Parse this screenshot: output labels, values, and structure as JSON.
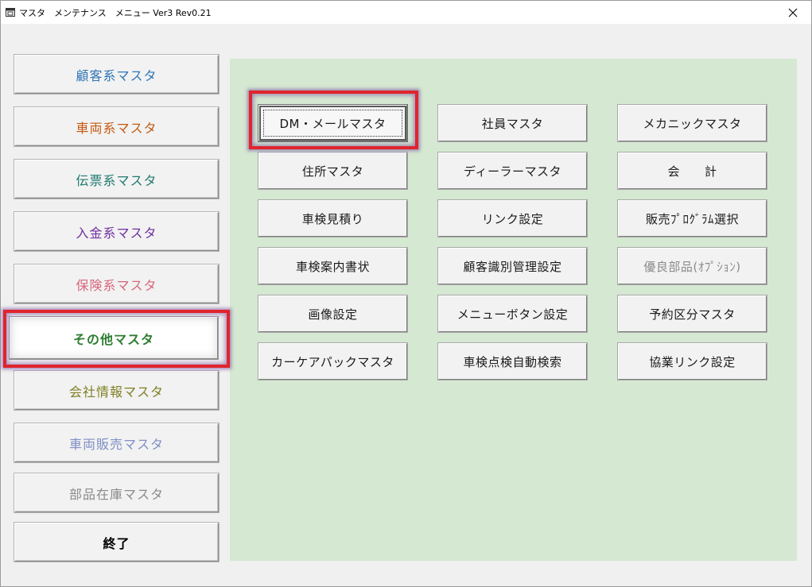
{
  "window": {
    "title": "マスタ　メンテナンス　メニュー Ver3 Rev0.21",
    "icon": "app-window-icon",
    "close_icon": "close-icon"
  },
  "sidebar": {
    "items": [
      {
        "label": "顧客系マスタ",
        "color": "#2e75b6"
      },
      {
        "label": "車両系マスタ",
        "color": "#c55a11"
      },
      {
        "label": "伝票系マスタ",
        "color": "#1f7a6f"
      },
      {
        "label": "入金系マスタ",
        "color": "#7030a0"
      },
      {
        "label": "保険系マスタ",
        "color": "#d6677a"
      },
      {
        "label": "その他マスタ",
        "color": "#2e7d32",
        "selected": true
      },
      {
        "label": "会社情報マスタ",
        "color": "#7f7f24"
      },
      {
        "label": "車両販売マスタ",
        "color": "#7f8fc6"
      },
      {
        "label": "部品在庫マスタ",
        "color": "#8a8a8a"
      },
      {
        "label": "終了",
        "color": "#000000"
      }
    ]
  },
  "grid": {
    "columns": [
      [
        {
          "label": "DM・メールマスタ",
          "focused": true
        },
        {
          "label": "住所マスタ"
        },
        {
          "label": "車検見積り"
        },
        {
          "label": "車検案内書状"
        },
        {
          "label": "画像設定"
        },
        {
          "label": "カーケアパックマスタ"
        }
      ],
      [
        {
          "label": "社員マスタ"
        },
        {
          "label": "ディーラーマスタ"
        },
        {
          "label": "リンク設定"
        },
        {
          "label": "顧客識別管理設定"
        },
        {
          "label": "メニューボタン設定"
        },
        {
          "label": "車検点検自動検索"
        }
      ],
      [
        {
          "label": "メカニックマスタ"
        },
        {
          "label": "会　　計"
        },
        {
          "label": "販売ﾌﾟﾛｸﾞﾗﾑ選択"
        },
        {
          "label": "優良部品(ｵﾌﾟｼｮﾝ)",
          "disabled": true
        },
        {
          "label": "予約区分マスタ"
        },
        {
          "label": "協業リンク設定"
        }
      ]
    ]
  },
  "colors": {
    "panel_bg": "#d5e8d2",
    "highlight": "#e0242c"
  }
}
